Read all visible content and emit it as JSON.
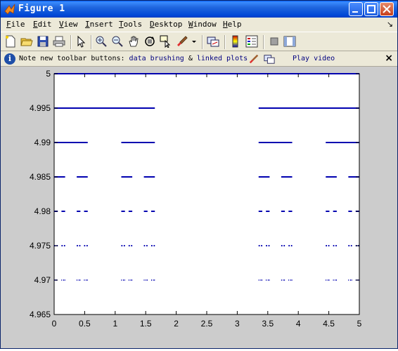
{
  "window": {
    "title": "Figure 1",
    "title_icon": "matlab-logo-icon",
    "controls": [
      "minimize-button",
      "maximize-button",
      "close-button"
    ]
  },
  "menu": {
    "items": [
      {
        "label": "File",
        "key": "F",
        "rest": "ile"
      },
      {
        "label": "Edit",
        "key": "E",
        "rest": "dit"
      },
      {
        "label": "View",
        "key": "V",
        "rest": "iew"
      },
      {
        "label": "Insert",
        "key": "I",
        "rest": "nsert"
      },
      {
        "label": "Tools",
        "key": "T",
        "rest": "ools"
      },
      {
        "label": "Desktop",
        "key": "D",
        "rest": "esktop"
      },
      {
        "label": "Window",
        "key": "W",
        "rest": "indow"
      },
      {
        "label": "Help",
        "key": "H",
        "rest": "elp"
      }
    ],
    "dock_glyph": "↘"
  },
  "toolbar": {
    "icons": [
      "new-figure-icon",
      "open-file-icon",
      "save-icon",
      "print-icon",
      "edit-plot-arrow-icon",
      "zoom-in-icon",
      "zoom-out-icon",
      "pan-hand-icon",
      "rotate-3d-icon",
      "data-cursor-icon",
      "brush-icon",
      "brush-dropdown-icon",
      "link-plot-icon",
      "insert-colorbar-icon",
      "insert-legend-icon",
      "hide-plot-tools-icon",
      "show-plot-tools-icon"
    ]
  },
  "infobar": {
    "prefix": "Note new toolbar buttons: ",
    "link1": "data brushing",
    "amp": " & ",
    "link2": "linked plots",
    "video": "Play video",
    "close": "×"
  },
  "colors": {
    "line": "#0000b0",
    "figure_bg": "#cccccc",
    "axes_bg": "#ffffff",
    "title_bar": "#0a5ad8"
  },
  "chart_data": {
    "type": "line",
    "xlim": [
      0,
      5
    ],
    "ylim": [
      4.965,
      5
    ],
    "xticks": [
      0,
      0.5,
      1,
      1.5,
      2,
      2.5,
      3,
      3.5,
      4,
      4.5,
      5
    ],
    "xtick_labels": [
      "0",
      "0.5",
      "1",
      "1.5",
      "2",
      "2.5",
      "3",
      "3.5",
      "4",
      "4.5",
      "5"
    ],
    "yticks": [
      4.965,
      4.97,
      4.975,
      4.98,
      4.985,
      4.99,
      4.995,
      5
    ],
    "ytick_labels": [
      "4.965",
      "4.97",
      "4.975",
      "4.98",
      "4.985",
      "4.99",
      "4.995",
      "5"
    ],
    "title": "",
    "xlabel": "",
    "ylabel": "",
    "grid": false,
    "series": [
      {
        "y": 5.0,
        "segments": [
          [
            0,
            5
          ]
        ]
      },
      {
        "y": 4.995,
        "segments": [
          [
            0,
            1.65
          ],
          [
            3.35,
            5
          ]
        ]
      },
      {
        "y": 4.99,
        "segments": [
          [
            0,
            0.55
          ],
          [
            1.1,
            1.65
          ],
          [
            3.35,
            3.9
          ],
          [
            4.45,
            5
          ]
        ]
      },
      {
        "y": 4.985,
        "segments": [
          [
            0,
            0.18
          ],
          [
            0.37,
            0.55
          ],
          [
            1.1,
            1.28
          ],
          [
            1.47,
            1.65
          ],
          [
            3.35,
            3.53
          ],
          [
            3.72,
            3.9
          ],
          [
            4.45,
            4.63
          ],
          [
            4.82,
            5
          ]
        ]
      },
      {
        "y": 4.98,
        "segments": [
          [
            0,
            0.06
          ],
          [
            0.12,
            0.18
          ],
          [
            0.37,
            0.43
          ],
          [
            0.49,
            0.55
          ],
          [
            1.1,
            1.16
          ],
          [
            1.22,
            1.28
          ],
          [
            1.47,
            1.53
          ],
          [
            1.59,
            1.65
          ],
          [
            3.35,
            3.41
          ],
          [
            3.47,
            3.53
          ],
          [
            3.72,
            3.78
          ],
          [
            3.84,
            3.9
          ],
          [
            4.45,
            4.51
          ],
          [
            4.57,
            4.63
          ],
          [
            4.82,
            4.88
          ],
          [
            4.94,
            5
          ]
        ]
      },
      {
        "y": 4.975,
        "segments": [
          [
            0.0,
            0.02
          ],
          [
            0.04,
            0.06
          ],
          [
            0.12,
            0.14
          ],
          [
            0.16,
            0.18
          ],
          [
            0.37,
            0.39
          ],
          [
            0.41,
            0.43
          ],
          [
            0.49,
            0.51
          ],
          [
            0.53,
            0.55
          ],
          [
            1.1,
            1.12
          ],
          [
            1.14,
            1.16
          ],
          [
            1.22,
            1.24
          ],
          [
            1.26,
            1.28
          ],
          [
            1.47,
            1.49
          ],
          [
            1.51,
            1.53
          ],
          [
            1.59,
            1.61
          ],
          [
            1.63,
            1.65
          ],
          [
            3.35,
            3.37
          ],
          [
            3.39,
            3.41
          ],
          [
            3.47,
            3.49
          ],
          [
            3.51,
            3.53
          ],
          [
            3.72,
            3.74
          ],
          [
            3.76,
            3.78
          ],
          [
            3.84,
            3.86
          ],
          [
            3.88,
            3.9
          ],
          [
            4.45,
            4.47
          ],
          [
            4.49,
            4.51
          ],
          [
            4.57,
            4.59
          ],
          [
            4.61,
            4.63
          ],
          [
            4.82,
            4.84
          ],
          [
            4.86,
            4.88
          ],
          [
            4.94,
            4.96
          ],
          [
            4.98,
            5
          ]
        ]
      },
      {
        "y": 4.97,
        "segments": [
          [
            0.0,
            0.01
          ],
          [
            0.02,
            0.03
          ],
          [
            0.04,
            0.05
          ],
          [
            0.12,
            0.13
          ],
          [
            0.15,
            0.16
          ],
          [
            0.17,
            0.18
          ],
          [
            0.37,
            0.38
          ],
          [
            0.4,
            0.41
          ],
          [
            0.42,
            0.43
          ],
          [
            0.49,
            0.5
          ],
          [
            0.52,
            0.53
          ],
          [
            0.54,
            0.55
          ],
          [
            1.1,
            1.11
          ],
          [
            1.13,
            1.14
          ],
          [
            1.15,
            1.16
          ],
          [
            1.22,
            1.23
          ],
          [
            1.25,
            1.26
          ],
          [
            1.27,
            1.28
          ],
          [
            1.47,
            1.48
          ],
          [
            1.5,
            1.51
          ],
          [
            1.52,
            1.53
          ],
          [
            1.59,
            1.6
          ],
          [
            1.62,
            1.63
          ],
          [
            1.64,
            1.65
          ],
          [
            3.35,
            3.36
          ],
          [
            3.38,
            3.39
          ],
          [
            3.4,
            3.41
          ],
          [
            3.47,
            3.48
          ],
          [
            3.5,
            3.51
          ],
          [
            3.52,
            3.53
          ],
          [
            3.72,
            3.73
          ],
          [
            3.75,
            3.76
          ],
          [
            3.77,
            3.78
          ],
          [
            3.84,
            3.85
          ],
          [
            3.87,
            3.88
          ],
          [
            3.89,
            3.9
          ],
          [
            4.45,
            4.46
          ],
          [
            4.48,
            4.49
          ],
          [
            4.5,
            4.51
          ],
          [
            4.57,
            4.58
          ],
          [
            4.6,
            4.61
          ],
          [
            4.62,
            4.63
          ],
          [
            4.82,
            4.83
          ],
          [
            4.85,
            4.86
          ],
          [
            4.87,
            4.88
          ],
          [
            4.94,
            4.95
          ],
          [
            4.97,
            4.98
          ],
          [
            4.99,
            5
          ]
        ]
      }
    ]
  }
}
